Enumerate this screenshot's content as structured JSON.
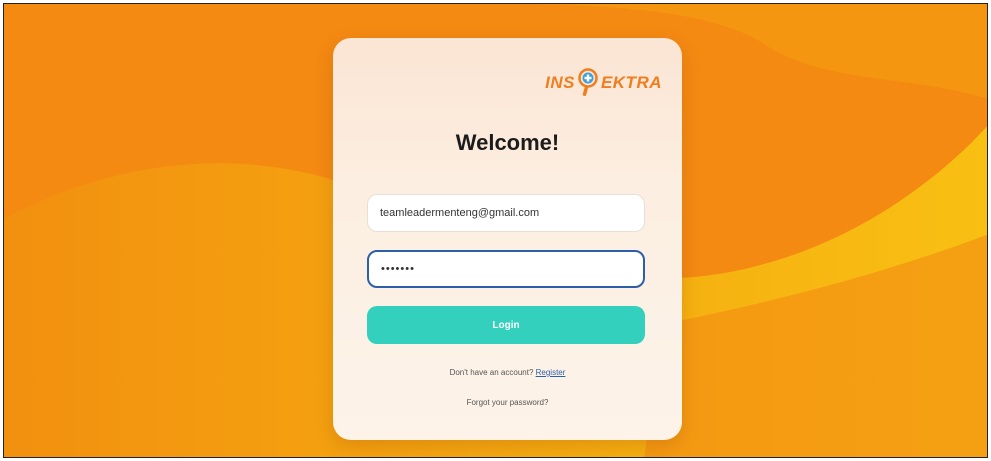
{
  "colors": {
    "bg_orange": "#f48a12",
    "bg_yellow": "#f7b20f",
    "accent_orange": "#f07d1e",
    "login_teal": "#33d1bd",
    "focus_blue": "#2d5fa8"
  },
  "logo": {
    "left_text": "INS",
    "right_text": "EKTRA",
    "icon": "magnifier-plus-icon"
  },
  "title": "Welcome!",
  "form": {
    "email_value": "teamleadermenteng@gmail.com",
    "password_value": "•••••••",
    "login_label": "Login"
  },
  "footer": {
    "register_prompt": "Don't have an account?",
    "register_link": "Register",
    "forgot_link": "Forgot your password?"
  }
}
